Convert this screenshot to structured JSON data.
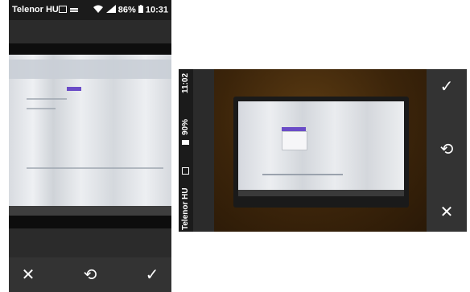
{
  "left_phone": {
    "status_bar": {
      "carrier": "Telenor HU",
      "battery": "86%",
      "time": "10:31"
    },
    "actions": [
      {
        "name": "cancel-button",
        "glyph": "✕"
      },
      {
        "name": "retake-button",
        "glyph": "⟲"
      },
      {
        "name": "confirm-button",
        "glyph": "✓"
      }
    ]
  },
  "right_phone": {
    "status_bar": {
      "carrier": "Telenor HU",
      "battery": "90%",
      "time": "11:02"
    },
    "actions": [
      {
        "name": "confirm-button",
        "glyph": "✓"
      },
      {
        "name": "retake-button",
        "glyph": "⟲"
      },
      {
        "name": "cancel-button",
        "glyph": "✕"
      }
    ]
  }
}
